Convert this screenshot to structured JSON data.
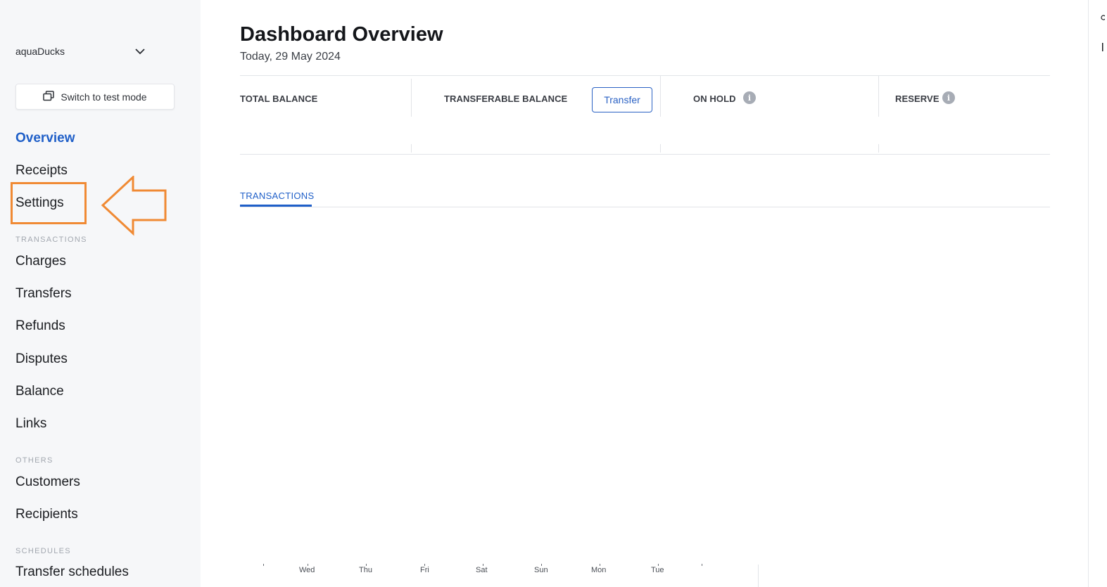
{
  "sidebar": {
    "account_name": "aquaDucks",
    "mode_button": "Switch to test mode",
    "items_primary": [
      {
        "label": "Overview",
        "active": true
      },
      {
        "label": "Receipts"
      },
      {
        "label": "Settings"
      }
    ],
    "sections": {
      "transactions": "TRANSACTIONS",
      "others": "OTHERS",
      "schedules": "SCHEDULES"
    },
    "items_transactions": [
      {
        "label": "Charges"
      },
      {
        "label": "Transfers"
      },
      {
        "label": "Refunds"
      },
      {
        "label": "Disputes"
      },
      {
        "label": "Balance"
      },
      {
        "label": "Links"
      }
    ],
    "items_others": [
      {
        "label": "Customers"
      },
      {
        "label": "Recipients"
      }
    ],
    "items_schedules": [
      {
        "label": "Transfer schedules"
      }
    ]
  },
  "main": {
    "title": "Dashboard Overview",
    "date": "Today, 29 May 2024",
    "cards": {
      "total_balance": {
        "label": "TOTAL BALANCE"
      },
      "transferable_balance": {
        "label": "TRANSFERABLE BALANCE",
        "button": "Transfer"
      },
      "on_hold": {
        "label": "ON HOLD"
      },
      "reserve": {
        "label": "RESERVE"
      }
    },
    "tabs": [
      {
        "label": "TRANSACTIONS",
        "active": true
      }
    ],
    "chart_days": [
      "Wed",
      "Thu",
      "Fri",
      "Sat",
      "Sun",
      "Mon",
      "Tue"
    ]
  },
  "colors": {
    "accent": "#1f5fc8",
    "highlight": "#f08a34",
    "sidebar_bg": "#f6f7f9"
  },
  "icons": [
    "chevron-down-icon",
    "switch-mode-icon",
    "info-icon",
    "arrow-annotation-icon"
  ]
}
